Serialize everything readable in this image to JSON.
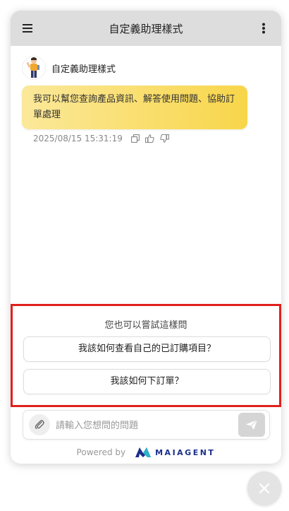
{
  "header": {
    "title": "自定義助理樣式",
    "menu_icon": "hamburger-menu-icon",
    "more_icon": "more-vertical-icon"
  },
  "chat": {
    "bot_name": "自定義助理樣式",
    "message": "我可以幫您查詢產品資訊、解答使用問題、協助訂單處理",
    "timestamp": "2025/08/15 15:31:19",
    "actions": [
      "copy-icon",
      "thumbs-up-icon",
      "thumbs-down-icon"
    ],
    "bubble_color": "#f8d64a"
  },
  "suggestions": {
    "title": "您也可以嘗試這樣問",
    "items": [
      "我該如何查看自己的已訂購項目？",
      "我該如何下訂單？"
    ]
  },
  "composer": {
    "placeholder": "請輸入您想問的問題",
    "attach_icon": "paperclip-icon",
    "send_icon": "send-icon"
  },
  "footer": {
    "powered_by": "Powered by",
    "brand": "MAIAGENT"
  },
  "colors": {
    "header_bg": "#dddddd",
    "highlight_border": "#e0201c",
    "brand": "#1a2f8c"
  }
}
